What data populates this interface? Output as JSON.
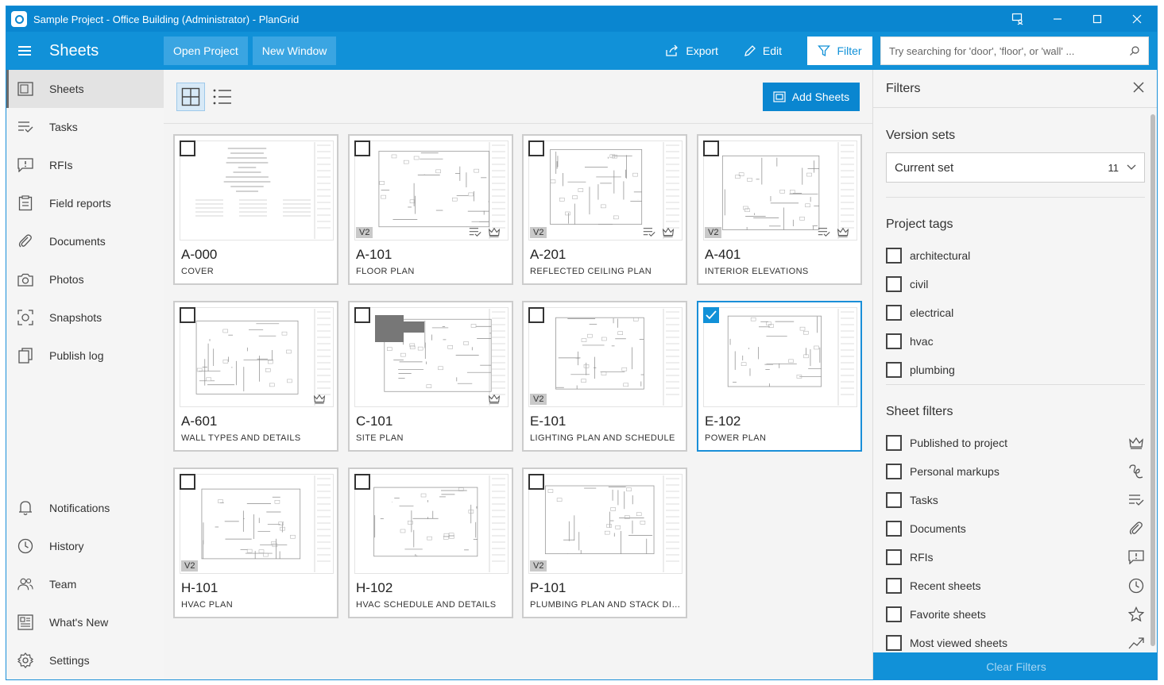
{
  "window": {
    "title": "Sample Project - Office Building (Administrator) - PlanGrid",
    "controls": [
      "⌐",
      "—",
      "☐",
      "✕"
    ]
  },
  "header": {
    "section_title": "Sheets",
    "open_project": "Open Project",
    "new_window": "New Window",
    "export": "Export",
    "edit": "Edit",
    "filter": "Filter",
    "search_placeholder": "Try searching for 'door', 'floor', or 'wall' ..."
  },
  "sidebar": {
    "items": [
      {
        "label": "Sheets",
        "icon": "sheets-icon"
      },
      {
        "label": "Tasks",
        "icon": "tasks-icon"
      },
      {
        "label": "RFIs",
        "icon": "rfis-icon"
      },
      {
        "label": "Field reports",
        "icon": "clipboard-icon"
      },
      {
        "label": "Documents",
        "icon": "paperclip-icon"
      },
      {
        "label": "Photos",
        "icon": "camera-icon"
      },
      {
        "label": "Snapshots",
        "icon": "snapshot-icon"
      },
      {
        "label": "Publish log",
        "icon": "publish-log-icon"
      }
    ],
    "bottom_items": [
      {
        "label": "Notifications",
        "icon": "bell-icon"
      },
      {
        "label": "History",
        "icon": "clock-icon"
      },
      {
        "label": "Team",
        "icon": "team-icon"
      },
      {
        "label": "What's New",
        "icon": "news-icon"
      },
      {
        "label": "Settings",
        "icon": "gear-icon"
      }
    ]
  },
  "toolbar": {
    "add_sheets": "Add Sheets"
  },
  "sheets": [
    {
      "code": "A-000",
      "name": "COVER",
      "version": "",
      "tasks": false,
      "published": false,
      "selected": false
    },
    {
      "code": "A-101",
      "name": "FLOOR PLAN",
      "version": "V2",
      "tasks": true,
      "published": true,
      "selected": false
    },
    {
      "code": "A-201",
      "name": "REFLECTED CEILING PLAN",
      "version": "V2",
      "tasks": true,
      "published": true,
      "selected": false
    },
    {
      "code": "A-401",
      "name": "INTERIOR ELEVATIONS",
      "version": "V2",
      "tasks": true,
      "published": true,
      "selected": false
    },
    {
      "code": "A-601",
      "name": "WALL TYPES AND DETAILS",
      "version": "",
      "tasks": false,
      "published": true,
      "selected": false
    },
    {
      "code": "C-101",
      "name": "SITE PLAN",
      "version": "",
      "tasks": false,
      "published": true,
      "selected": false
    },
    {
      "code": "E-101",
      "name": "LIGHTING PLAN AND SCHEDULE",
      "version": "V2",
      "tasks": false,
      "published": false,
      "selected": false
    },
    {
      "code": "E-102",
      "name": "POWER PLAN",
      "version": "",
      "tasks": false,
      "published": false,
      "selected": true
    },
    {
      "code": "H-101",
      "name": "HVAC PLAN",
      "version": "V2",
      "tasks": false,
      "published": false,
      "selected": false
    },
    {
      "code": "H-102",
      "name": "HVAC SCHEDULE AND DETAILS",
      "version": "",
      "tasks": false,
      "published": false,
      "selected": false
    },
    {
      "code": "P-101",
      "name": "PLUMBING PLAN AND STACK DIAG...",
      "version": "V2",
      "tasks": false,
      "published": false,
      "selected": false
    }
  ],
  "filters": {
    "title": "Filters",
    "version_sets_title": "Version sets",
    "version_set_value": "Current set",
    "version_set_count": "11",
    "project_tags_title": "Project tags",
    "project_tags": [
      "architectural",
      "civil",
      "electrical",
      "hvac",
      "plumbing"
    ],
    "sheet_filters_title": "Sheet filters",
    "sheet_filters": [
      {
        "label": "Published to project",
        "icon": "crown-icon"
      },
      {
        "label": "Personal markups",
        "icon": "markup-icon"
      },
      {
        "label": "Tasks",
        "icon": "tasks-icon"
      },
      {
        "label": "Documents",
        "icon": "paperclip-icon"
      },
      {
        "label": "RFIs",
        "icon": "rfis-icon"
      },
      {
        "label": "Recent sheets",
        "icon": "clock-icon"
      },
      {
        "label": "Favorite sheets",
        "icon": "star-icon"
      },
      {
        "label": "Most viewed sheets",
        "icon": "trending-icon"
      }
    ],
    "clear_filters": "Clear Filters"
  },
  "colors": {
    "accent": "#1191d8",
    "titlebar": "#0a86d0"
  }
}
